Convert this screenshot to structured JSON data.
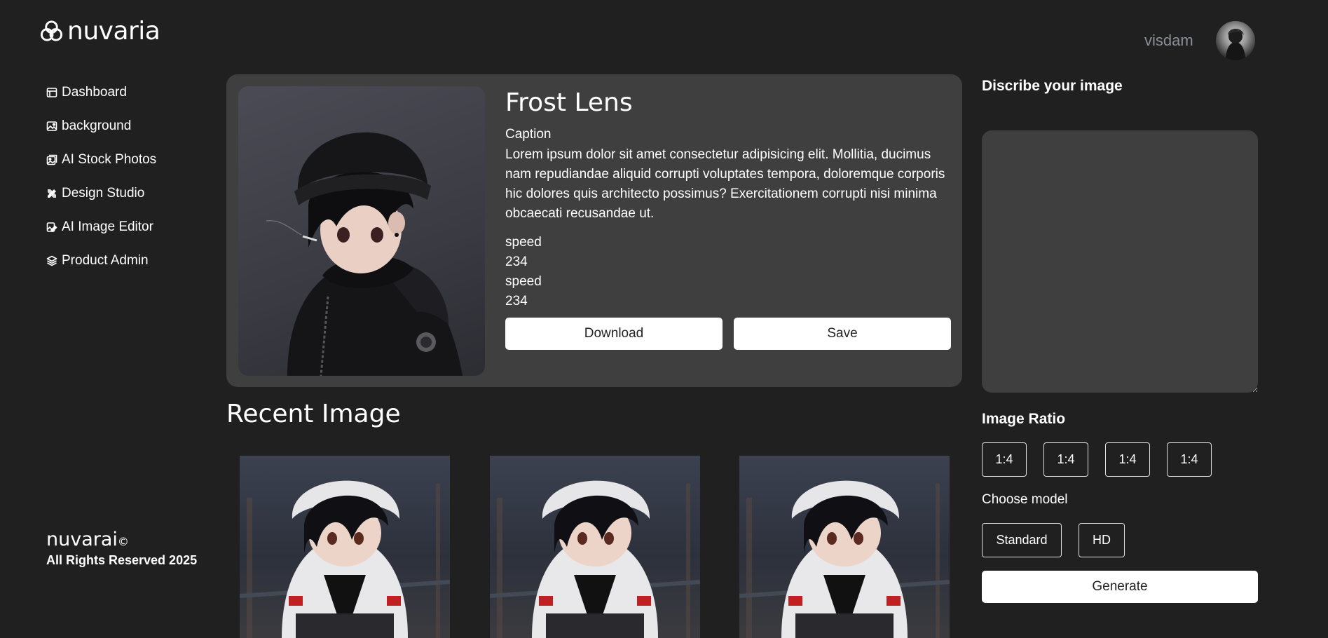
{
  "brand": {
    "name": "nuvaria",
    "logo_icon": "three-circles-logo-icon"
  },
  "sidebar": {
    "items": [
      {
        "label": "Dashboard",
        "icon": "dashboard-icon"
      },
      {
        "label": "background",
        "icon": "image-edit-icon"
      },
      {
        "label": "AI Stock Photos",
        "icon": "photo-stack-icon"
      },
      {
        "label": "Design Studio",
        "icon": "design-tools-icon"
      },
      {
        "label": "AI Image Editor",
        "icon": "image-editor-icon"
      },
      {
        "label": "Product Admin",
        "icon": "layers-icon"
      }
    ]
  },
  "footer": {
    "brand": "nuvarai",
    "copyright_symbol": "©",
    "rights": "All Rights Reserved 2025"
  },
  "header": {
    "username": "visdam"
  },
  "featured": {
    "title": "Frost Lens",
    "caption_label": "Caption",
    "caption": "Lorem ipsum dolor sit amet consectetur adipisicing elit. Mollitia, ducimus nam repudiandae aliquid corrupti voluptates tempora, doloremque corporis hic dolores quis architecto possimus? Exercitationem corrupti nisi minima obcaecati recusandae ut.",
    "stats": [
      {
        "label": "speed",
        "value": "234"
      },
      {
        "label": "speed",
        "value": "234"
      }
    ],
    "download_label": "Download",
    "save_label": "Save"
  },
  "recent": {
    "title": "Recent Image",
    "count": 3
  },
  "panel": {
    "describe_label": "Discribe your image",
    "prompt_value": "",
    "ratio_label": "Image Ratio",
    "ratios": [
      "1:4",
      "1:4",
      "1:4",
      "1:4"
    ],
    "model_label": "Choose model",
    "models": [
      "Standard",
      "HD"
    ],
    "generate_label": "Generate"
  },
  "colors": {
    "background": "#202020",
    "card": "#3f3f3f",
    "muted_text": "#8a8f98",
    "button": "#ffffff"
  }
}
